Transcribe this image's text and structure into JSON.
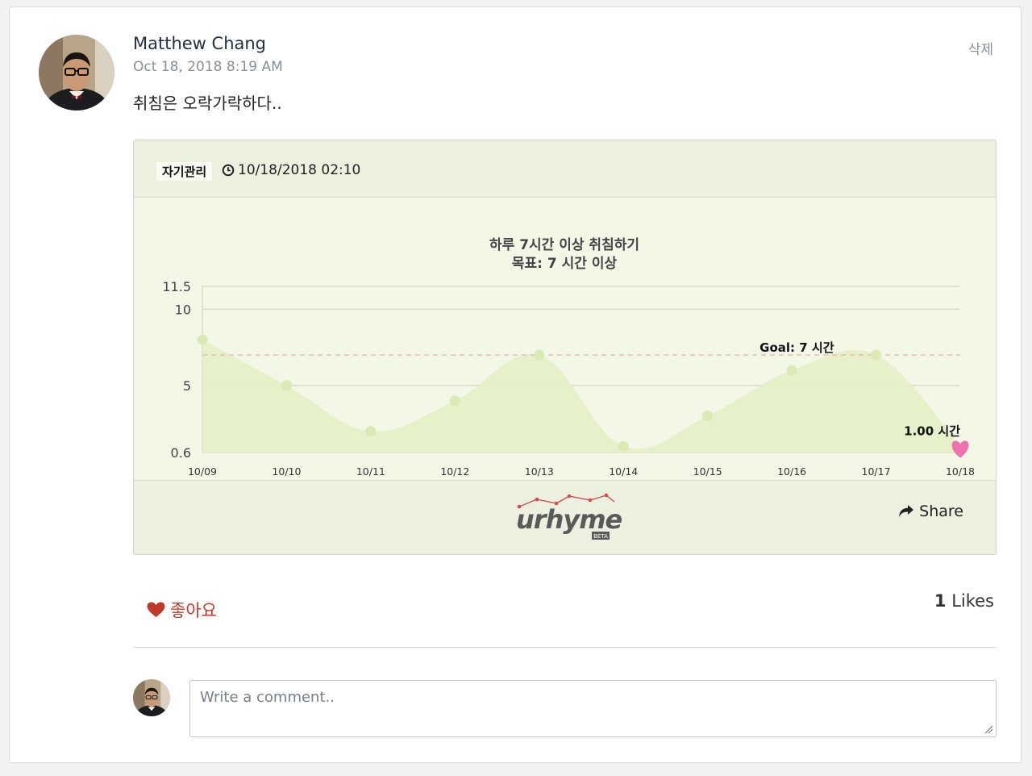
{
  "post": {
    "author": "Matthew Chang",
    "timestamp": "Oct 18, 2018 8:19 AM",
    "text": "취침은 오락가락하다..",
    "delete_label": "삭제"
  },
  "card": {
    "category": "자기관리",
    "date": "10/18/2018 02:10",
    "logo_text": "urhyme",
    "logo_badge": "BETA",
    "share_label": "Share",
    "clock_icon": "clock-icon",
    "share_icon": "share-arrow-icon"
  },
  "chart_data": {
    "type": "area",
    "title": "하루 7시간 이상 취침하기",
    "subtitle": "목표: 7 시간 이상",
    "categories": [
      "10/09",
      "10/10",
      "10/11",
      "10/12",
      "10/13",
      "10/14",
      "10/15",
      "10/16",
      "10/17",
      "10/18"
    ],
    "values": [
      8,
      5,
      2,
      4,
      7,
      1,
      3,
      6,
      7,
      1
    ],
    "y_ticks": [
      "0.6",
      "5",
      "10",
      "11.5"
    ],
    "ylim": [
      0.6,
      11.5
    ],
    "goal_value": 7,
    "goal_label": "Goal: 7 시간",
    "last_value_label": "1.00 시간",
    "colors": {
      "fill": "#e4f0c7",
      "point": "#dbe9b4",
      "goal_line": "#e8a5a5",
      "heart": "#f06fb0",
      "grid": "#d9dccc"
    }
  },
  "actions": {
    "like_label": "좋아요",
    "like_count": "1",
    "likes_suffix": " Likes"
  },
  "comment": {
    "placeholder": "Write a comment.."
  },
  "colors": {
    "like_red": "#c0392b",
    "card_bg": "#f2f7e6",
    "card_header_bg": "#ebf0df"
  }
}
